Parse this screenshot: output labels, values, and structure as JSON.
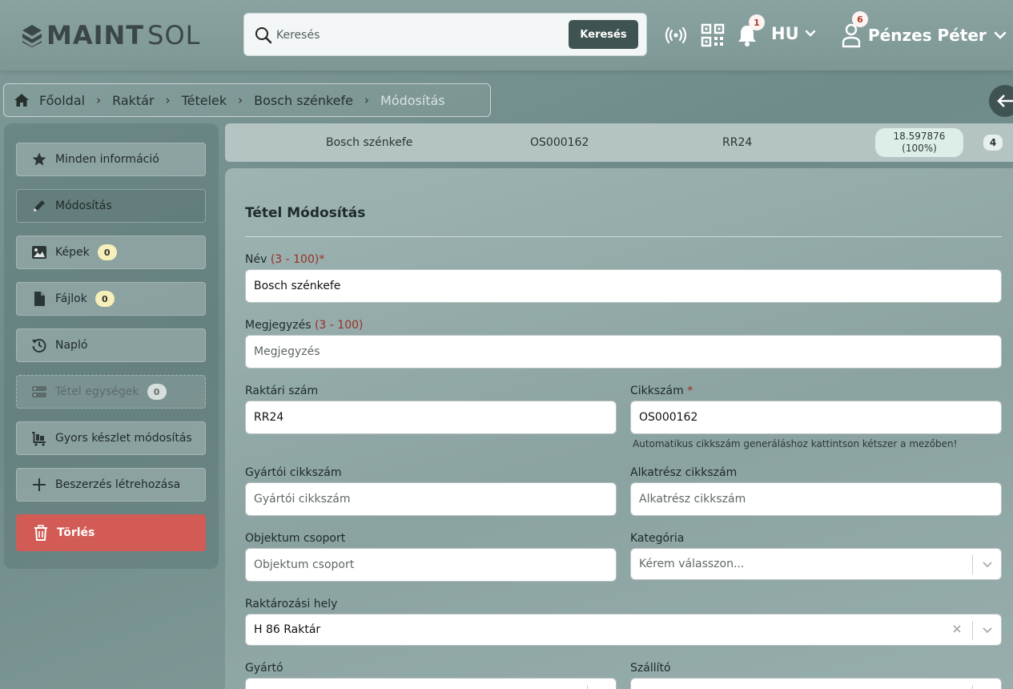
{
  "header": {
    "logo_bold": "MAINT",
    "logo_light": "SOL",
    "search_placeholder": "Keresés",
    "search_button": "Keresés",
    "notifications_count": "1",
    "language": "HU",
    "user_badge_count": "6",
    "user_name": "Pénzes Péter"
  },
  "breadcrumb": [
    "Főoldal",
    "Raktár",
    "Tételek",
    "Bosch szénkefe",
    "Módosítás"
  ],
  "sidebar": {
    "items": [
      {
        "label": "Minden információ",
        "icon": "star-icon"
      },
      {
        "label": "Módosítás",
        "icon": "pencil-icon"
      },
      {
        "label": "Képek",
        "icon": "image-icon",
        "count": "0"
      },
      {
        "label": "Fájlok",
        "icon": "file-icon",
        "count": "0"
      },
      {
        "label": "Napló",
        "icon": "history-icon"
      },
      {
        "label": "Tétel egységek",
        "icon": "storage-icon",
        "count": "0"
      },
      {
        "label": "Gyors készlet módosítás",
        "icon": "cart-icon"
      },
      {
        "label": "Beszerzés létrehozása",
        "icon": "plus-icon"
      },
      {
        "label": "Törlés",
        "icon": "trash-icon"
      }
    ]
  },
  "infobar": {
    "name": "Bosch szénkefe",
    "article": "OS000162",
    "stock_no": "RR24",
    "quantity": "18.597876",
    "percent": "(100%)",
    "count": "4"
  },
  "form": {
    "title": "Tétel Módosítás",
    "name_label": "Név",
    "name_range": "(3 - 100)*",
    "name_value": "Bosch szénkefe",
    "note_label": "Megjegyzés",
    "note_range": "(3 - 100)",
    "note_placeholder": "Megjegyzés",
    "stock_label": "Raktári szám",
    "stock_value": "RR24",
    "article_label": "Cikkszám",
    "article_req": "*",
    "article_value": "OS000162",
    "article_hint": "Automatikus cikkszám generáláshoz kattintson kétszer a mezőben!",
    "mfr_article_label": "Gyártói cikkszám",
    "mfr_article_placeholder": "Gyártói cikkszám",
    "part_article_label": "Alkatrész cikkszám",
    "part_article_placeholder": "Alkatrész cikkszám",
    "object_group_label": "Objektum csoport",
    "object_group_placeholder": "Objektum csoport",
    "category_label": "Kategória",
    "category_placeholder": "Kérem válasszon...",
    "location_label": "Raktározási hely",
    "location_value": "H 86 Raktár",
    "manufacturer_label": "Gyártó",
    "supplier_label": "Szállító"
  },
  "colors": {
    "accent": "#3f5452",
    "danger": "#d25b55",
    "required": "#9c2d25"
  }
}
